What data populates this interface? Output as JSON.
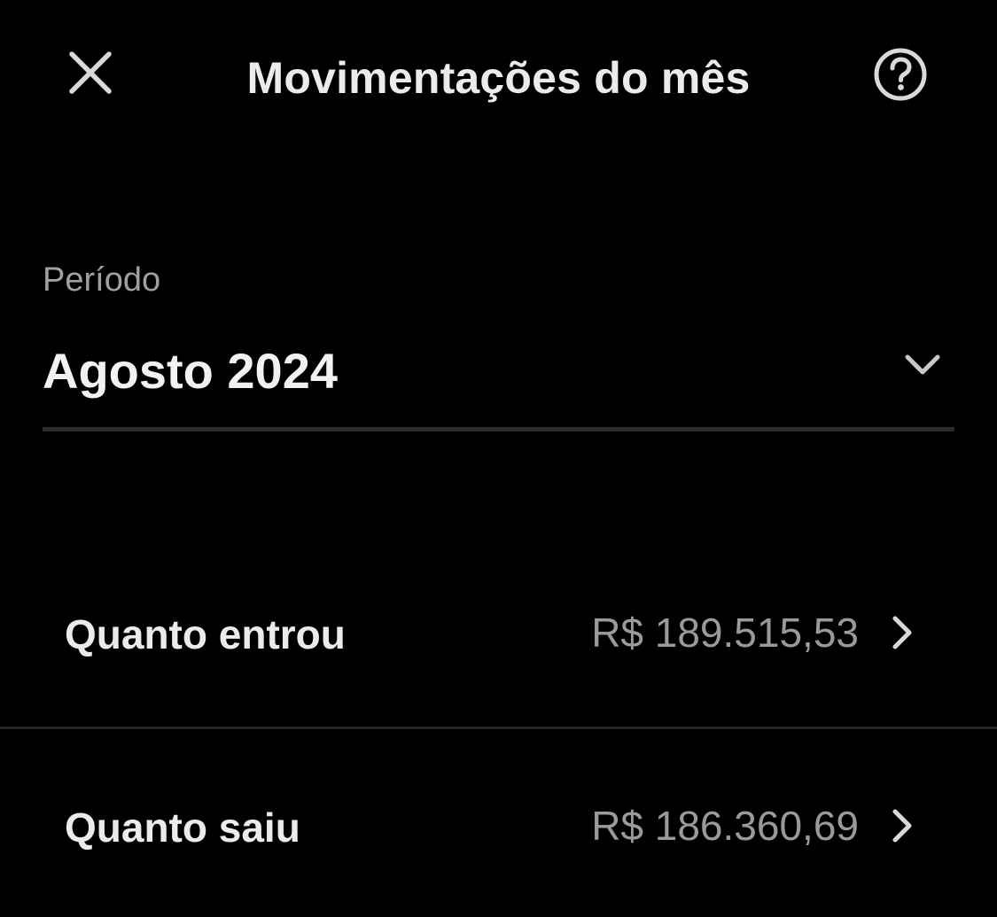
{
  "header": {
    "title": "Movimentações do mês",
    "close_icon": "close-icon",
    "help_icon": "help-circle-icon"
  },
  "period": {
    "label": "Período",
    "selected": "Agosto 2024",
    "dropdown_icon": "chevron-down-icon"
  },
  "summary": {
    "rows": [
      {
        "label": "Quanto entrou",
        "value": "R$ 189.515,53",
        "icon": "chevron-right-icon"
      },
      {
        "label": "Quanto saiu",
        "value": "R$ 186.360,69",
        "icon": "chevron-right-icon"
      }
    ]
  },
  "colors": {
    "background": "#000000",
    "primary_text": "#ebebeb",
    "secondary_text": "#9a9a9a",
    "divider": "#262626"
  }
}
